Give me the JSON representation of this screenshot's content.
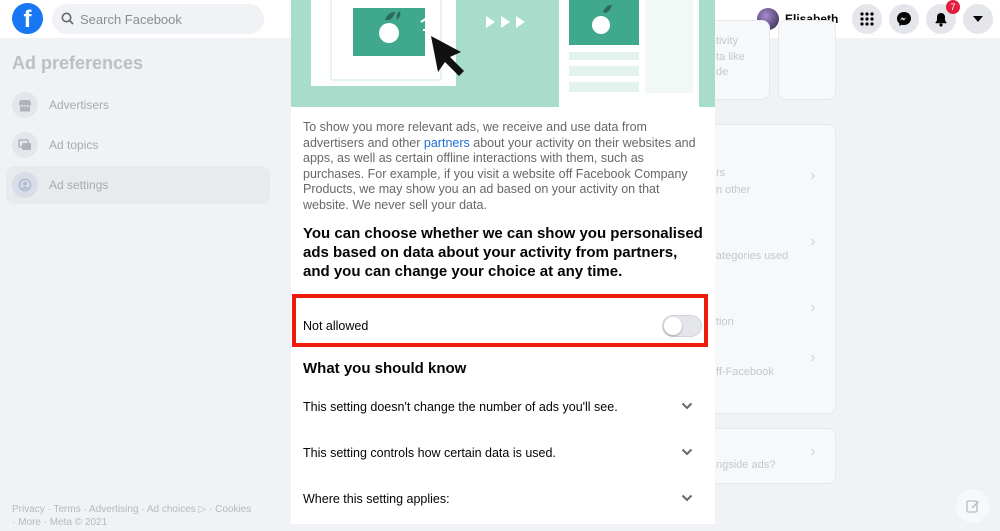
{
  "topbar": {
    "logo": "f",
    "search_placeholder": "Search Facebook",
    "profile_name": "Elisabeth",
    "notification_count": "7"
  },
  "sidebar": {
    "title": "Ad preferences",
    "items": [
      {
        "label": "Advertisers",
        "icon": "storefront-icon"
      },
      {
        "label": "Ad topics",
        "icon": "topics-icon"
      },
      {
        "label": "Ad settings",
        "icon": "gear-person-icon"
      }
    ],
    "footer": [
      "Privacy · Terms · Advertising · Ad choices ▷ · Cookies",
      "· More · Meta © 2021"
    ]
  },
  "background": {
    "card1_lines": [
      "tivity",
      "ta like",
      "de"
    ],
    "rows": [
      "rs",
      "n other",
      "ategories used",
      "tion",
      "ff-Facebook",
      "ngside ads?"
    ]
  },
  "modal": {
    "intro_part1": "To show you more relevant ads, we receive and use data from advertisers and other ",
    "intro_link": "partners",
    "intro_part2": " about your activity on their websites and apps, as well as certain offline interactions with them, such as purchases. For example, if you visit a website off Facebook Company Products, we may show you an ad based on your activity on that website. We never sell your data.",
    "heading": "You can choose whether we can show you personalised ads based on data about your activity from partners, and you can change your choice at any time.",
    "toggle_label": "Not allowed",
    "toggle_on": false,
    "know_title": "What you should know",
    "accordions": [
      "This setting doesn't change the number of ads you'll see.",
      "This setting controls how certain data is used.",
      "Where this setting applies:"
    ]
  },
  "colors": {
    "brand": "#1877f2",
    "illustration_bg": "#a8dccb",
    "highlight": "#ef1c0e",
    "link": "#216fdb"
  }
}
